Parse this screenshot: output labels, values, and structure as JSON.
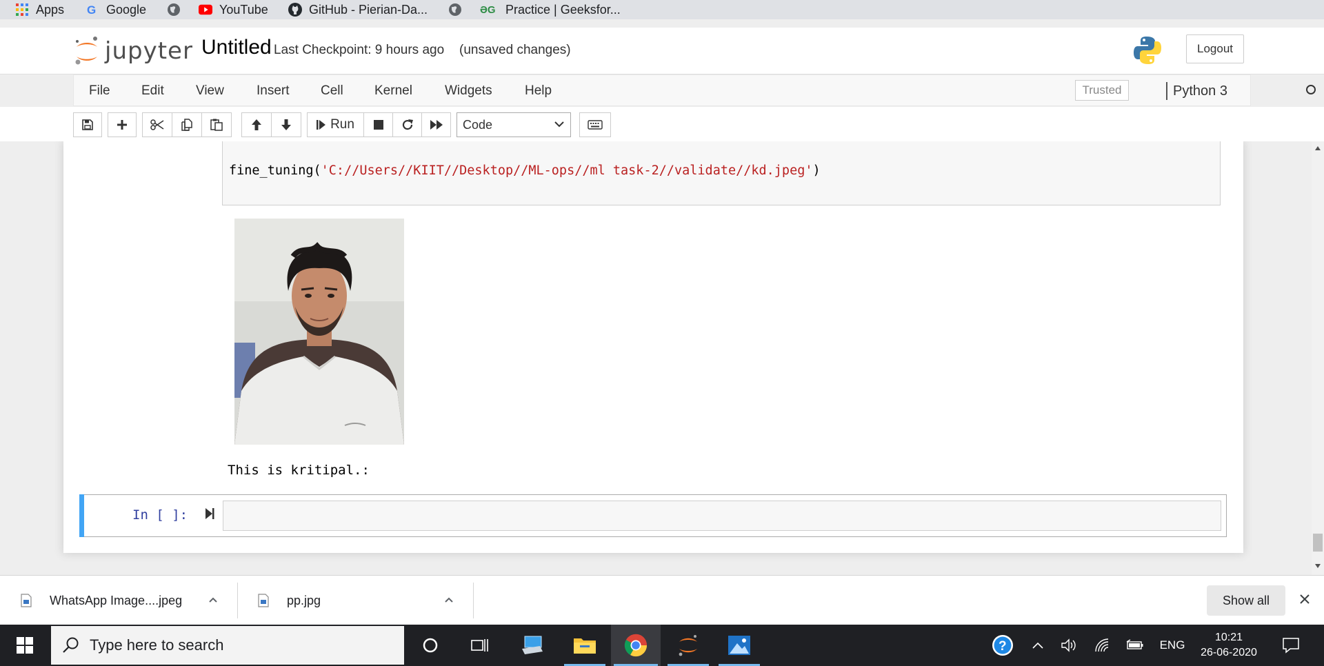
{
  "bookmarks": [
    {
      "label": "Apps",
      "icon": "apps-grid-icon"
    },
    {
      "label": "Google",
      "icon": "google-icon"
    },
    {
      "label": "",
      "icon": "globe-icon"
    },
    {
      "label": "YouTube",
      "icon": "youtube-icon"
    },
    {
      "label": "GitHub - Pierian-Da...",
      "icon": "github-icon"
    },
    {
      "label": "",
      "icon": "globe-icon"
    },
    {
      "label": "Practice | Geeksfor...",
      "icon": "geeksforgeeks-icon"
    }
  ],
  "header": {
    "logo_text": "jupyter",
    "notebook_title": "Untitled",
    "checkpoint": "Last Checkpoint: 9 hours ago",
    "unsaved": "(unsaved changes)",
    "logout_label": "Logout"
  },
  "menubar": {
    "items": [
      "File",
      "Edit",
      "View",
      "Insert",
      "Cell",
      "Kernel",
      "Widgets",
      "Help"
    ],
    "trusted_label": "Trusted",
    "kernel_name": "Python 3"
  },
  "toolbar": {
    "run_label": "Run",
    "cell_type": "Code",
    "icons": [
      "save-icon",
      "add-cell-icon",
      "cut-icon",
      "copy-icon",
      "paste-icon",
      "move-up-icon",
      "move-down-icon",
      "run-icon",
      "stop-icon",
      "restart-icon",
      "fast-forward-icon",
      "keyboard-icon"
    ]
  },
  "notebook": {
    "code_func": "fine_tuning(",
    "code_string": "'C://Users//KIIT//Desktop//ML-ops//ml task-2//validate//kd.jpeg'",
    "code_close": ")",
    "output_text": "This is kritipal.:",
    "empty_cell_prompt": "In [ ]:"
  },
  "downloads": {
    "items": [
      {
        "name": "WhatsApp Image....jpeg"
      },
      {
        "name": "pp.jpg"
      }
    ],
    "show_all_label": "Show all"
  },
  "taskbar": {
    "search_placeholder": "Type here to search",
    "language": "ENG",
    "time": "10:21",
    "date": "26-06-2020"
  },
  "colors": {
    "jupyter_orange": "#f37726",
    "cell_selected_bar": "#42a5f5",
    "code_string": "#ba2121",
    "prompt_blue": "#303f9f",
    "taskbar_bg": "#1f2024"
  }
}
